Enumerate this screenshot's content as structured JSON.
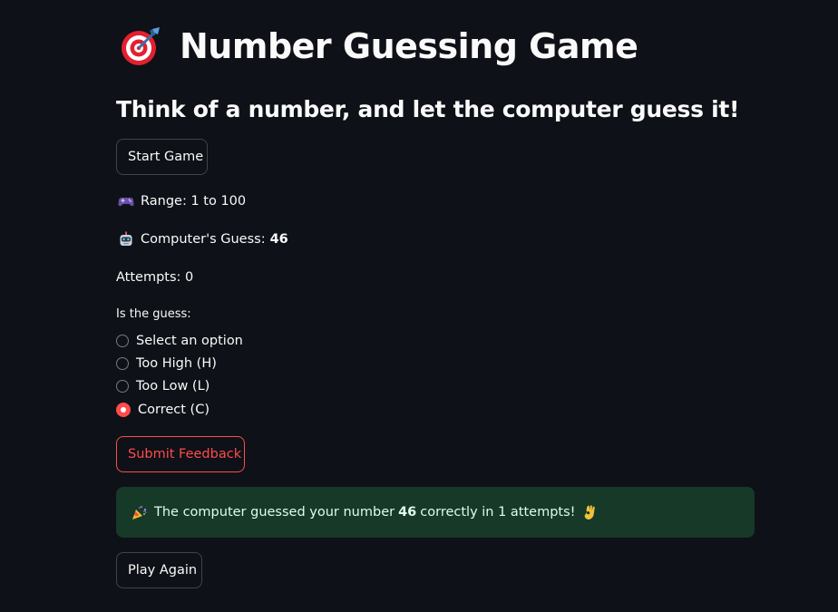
{
  "header": {
    "title_icon": "target-icon",
    "title": "Number Guessing Game",
    "subtitle": "Think of a number, and let the computer guess it!"
  },
  "start_button": {
    "label": "Start Game"
  },
  "info": {
    "range_icon": "gamepad-icon",
    "range_text": "Range: 1 to 100",
    "guess_icon": "robot-icon",
    "guess_label": "Computer's Guess:",
    "guess_value": "46",
    "attempts_text": "Attempts: 0"
  },
  "feedback": {
    "label": "Is the guess:",
    "options": [
      "Select an option",
      "Too High (H)",
      "Too Low (L)",
      "Correct (C)"
    ],
    "selected": "Correct (C)"
  },
  "submit_button": {
    "label": "Submit Feedback"
  },
  "result": {
    "icon": "party-popper-icon",
    "text_before": "The computer guessed your number",
    "number": "46",
    "text_after": "correctly in 1 attempts!",
    "end_icon": "ok-hand-icon"
  },
  "play_again_button": {
    "label": "Play Again"
  },
  "colors": {
    "background": "#0e1117",
    "accent": "#ff4b4b",
    "success_bg": "#173928",
    "success_text": "#dffde9"
  }
}
